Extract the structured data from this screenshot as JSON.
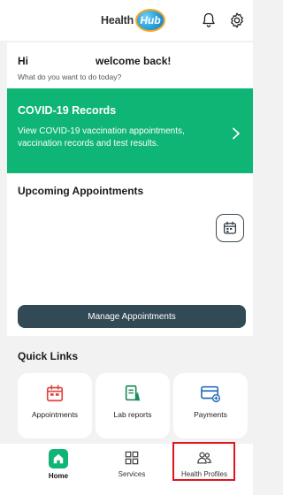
{
  "header": {
    "logo_text": "Health",
    "logo_badge": "Hub",
    "bell_icon": "bell-icon",
    "settings_icon": "gear-icon"
  },
  "greeting": {
    "hi": "Hi",
    "welcome": "welcome back!",
    "subtitle": "What do you want to do today?"
  },
  "covid": {
    "title": "COVID-19 Records",
    "description": "View COVID-19 vaccination appointments, vaccination records and test results.",
    "chevron_icon": "chevron-right-icon",
    "color": "#0fb574"
  },
  "appointments": {
    "title": "Upcoming Appointments",
    "calendar_icon": "calendar-icon",
    "manage_label": "Manage Appointments",
    "button_color": "#324a55"
  },
  "quick_links": {
    "title": "Quick Links",
    "items": [
      {
        "label": "Appointments",
        "icon": "calendar-icon"
      },
      {
        "label": "Lab reports",
        "icon": "lab-report-icon"
      },
      {
        "label": "Payments",
        "icon": "card-payment-icon"
      }
    ]
  },
  "nav": {
    "items": [
      {
        "label": "Home",
        "icon": "home-icon",
        "active": true
      },
      {
        "label": "Services",
        "icon": "grid-icon",
        "active": false
      },
      {
        "label": "Health Profiles",
        "icon": "people-icon",
        "active": false
      }
    ],
    "highlight_color": "#e0141e"
  }
}
